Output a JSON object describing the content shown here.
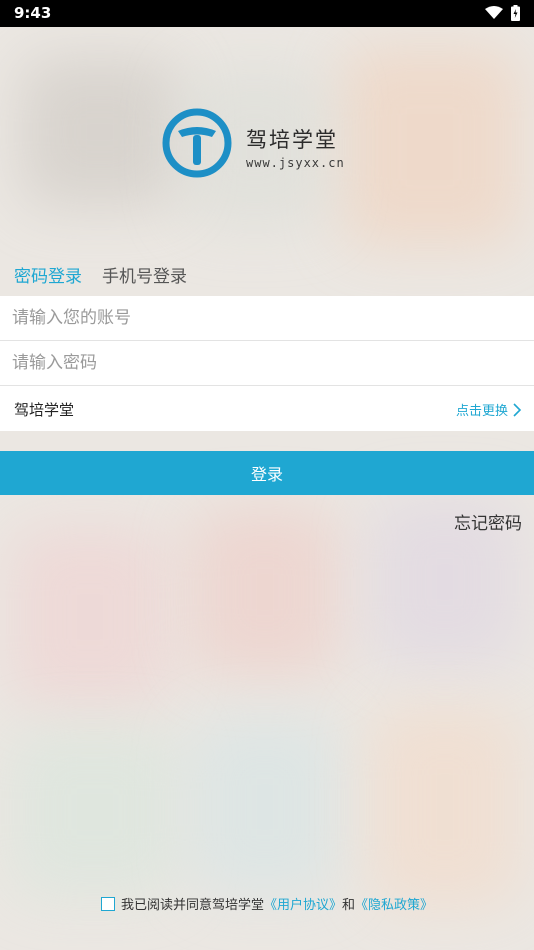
{
  "status_bar": {
    "time": "9:43"
  },
  "brand": {
    "name": "驾培学堂",
    "url": "www.jsyxx.cn"
  },
  "tabs": [
    {
      "label": "密码登录",
      "active": true
    },
    {
      "label": "手机号登录",
      "active": false
    }
  ],
  "form": {
    "account_placeholder": "请输入您的账号",
    "password_placeholder": "请输入密码",
    "school_name": "驾培学堂",
    "change_label": "点击更换"
  },
  "login_button": "登录",
  "forgot_password": "忘记密码",
  "agreement": {
    "prefix": "我已阅读并同意驾培学堂",
    "user_agreement": "《用户协议》",
    "and": "和",
    "privacy_policy": "《隐私政策》"
  },
  "colors": {
    "accent": "#1fa7d2"
  },
  "icons": [
    "wifi-icon",
    "battery-icon",
    "chevron-right-icon"
  ]
}
